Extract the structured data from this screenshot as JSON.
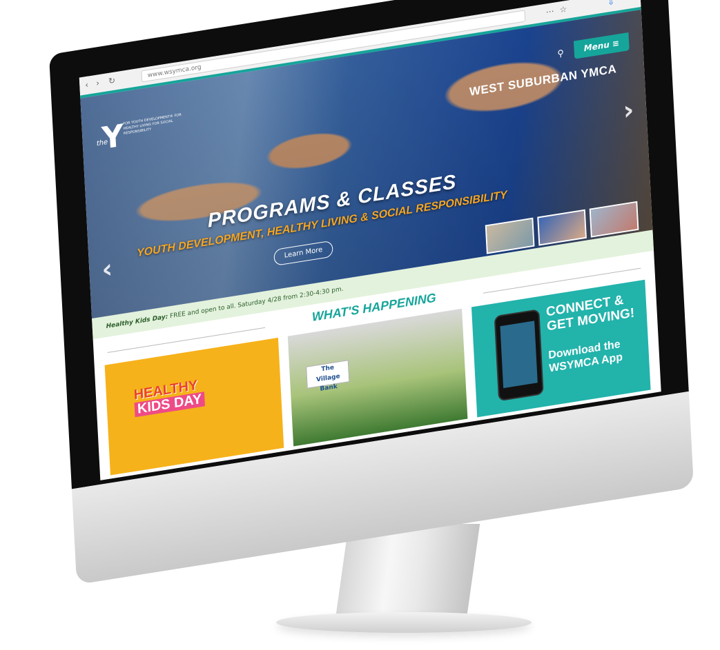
{
  "browser": {
    "url": "www.wsymca.org"
  },
  "header": {
    "logo_the": "the",
    "logo_y": "Y",
    "tagline": "FOR YOUTH DEVELOPMENT® FOR HEALTHY LIVING FOR SOCIAL RESPONSIBILITY",
    "site_name": "WEST SUBURBAN YMCA",
    "menu_label": "Menu ≡",
    "search_icon": "search-icon"
  },
  "hero": {
    "title": "PROGRAMS & CLASSES",
    "subtitle": "YOUTH DEVELOPMENT, HEALTHY LIVING & SOCIAL RESPONSIBILITY",
    "cta": "Learn More",
    "prev_arrow": "‹",
    "next_arrow": "›"
  },
  "announcement": {
    "label": "Healthy Kids Day:",
    "text": " FREE and open to all. Saturday 4/28 from 2:30-4:30 pm."
  },
  "whats_happening": {
    "title": "WHAT'S HAPPENING",
    "cards": [
      {
        "line1": "HEALTHY",
        "line2": "KIDS DAY"
      },
      {
        "bank_line1": "The",
        "bank_line2": "Village Bank"
      },
      {
        "title_line1": "CONNECT &",
        "title_line2": "GET MOVING!",
        "sub_line1": "Download the",
        "sub_line2": "WSYMCA App"
      }
    ]
  },
  "colors": {
    "accent": "#16a59a",
    "highlight": "#f5a623",
    "announce_bg": "#e3f2dc"
  }
}
